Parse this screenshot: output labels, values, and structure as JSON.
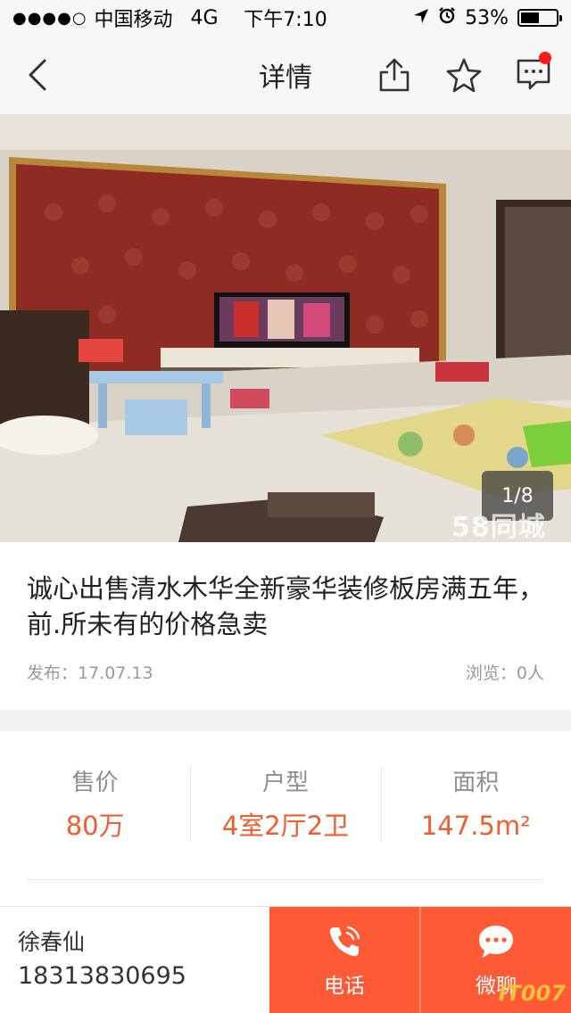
{
  "status_bar": {
    "carrier": "中国移动",
    "network": "4G",
    "time": "下午7:10",
    "battery": "53%"
  },
  "nav": {
    "title": "详情"
  },
  "photo": {
    "counter": "1/8",
    "watermark": "58同城"
  },
  "listing": {
    "title": "诚心出售清水木华全新豪华装修板房满五年，前.所未有的价格急卖",
    "published": "发布：17.07.13",
    "views": "浏览：0人"
  },
  "info": {
    "price_label": "售价",
    "price_value": "80万",
    "layout_label": "户型",
    "layout_value": "4室2厅2卫",
    "area_label": "面积",
    "area_value": "147.5m²"
  },
  "contact": {
    "name": "徐春仙",
    "phone": "18313830695",
    "call_label": "电话",
    "chat_label": "微聊",
    "corner_logo": "IT007"
  },
  "colors": {
    "accent": "#ff5a36",
    "value_orange": "#f25c2e",
    "notification_dot": "#ff1a1a"
  }
}
